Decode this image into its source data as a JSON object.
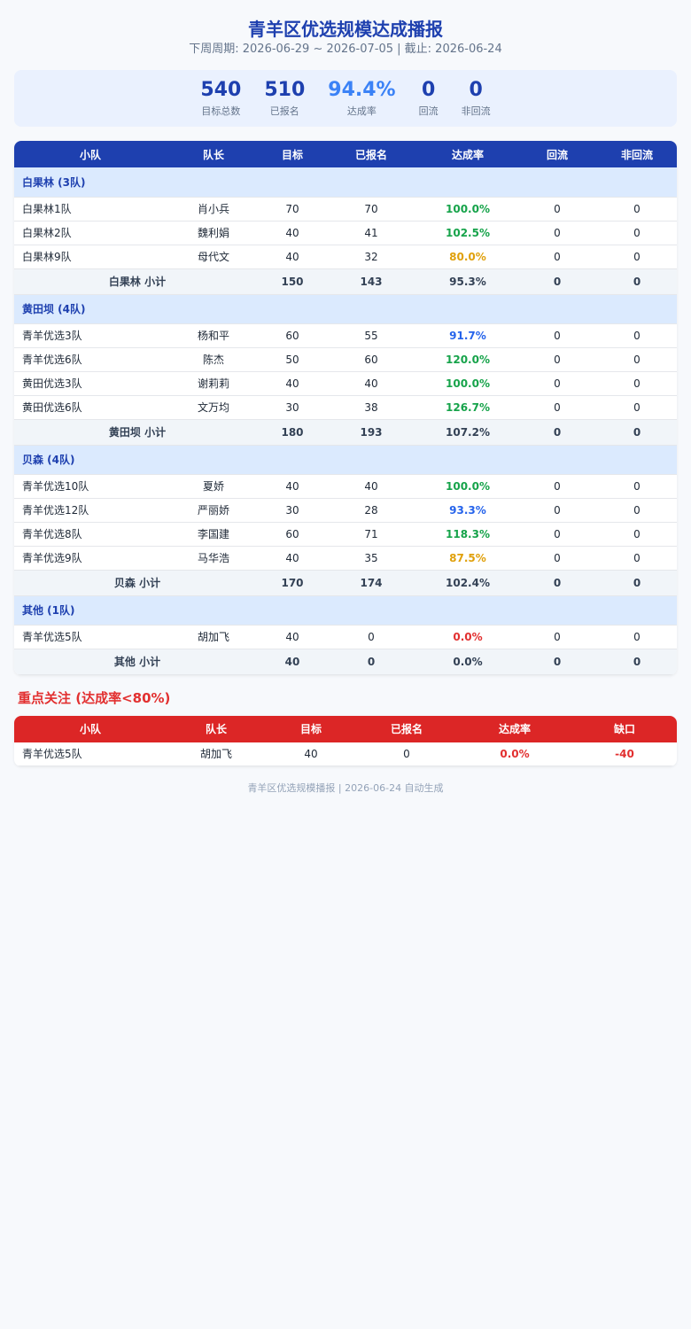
{
  "header": {
    "title": "青羊区优选规模达成播报",
    "subtitle": "下周周期: 2026-06-29 ~ 2026-07-05 | 截止: 2026-06-24"
  },
  "summary": [
    {
      "value": "540",
      "label": "目标总数"
    },
    {
      "value": "510",
      "label": "已报名"
    },
    {
      "value": "94.4%",
      "label": "达成率"
    },
    {
      "value": "0",
      "label": "回流"
    },
    {
      "value": "0",
      "label": "非回流"
    }
  ],
  "main_table": {
    "columns": [
      "小队",
      "队长",
      "目标",
      "已报名",
      "达成率",
      "回流",
      "非回流"
    ],
    "groups": [
      {
        "name": "白果林 (3队)",
        "rows": [
          {
            "team": "白果林1队",
            "leader": "肖小兵",
            "target": "70",
            "signed": "70",
            "rate": "100.0%",
            "rate_color": "green",
            "back": "0",
            "nonback": "0"
          },
          {
            "team": "白果林2队",
            "leader": "魏利娟",
            "target": "40",
            "signed": "41",
            "rate": "102.5%",
            "rate_color": "green",
            "back": "0",
            "nonback": "0"
          },
          {
            "team": "白果林9队",
            "leader": "母代文",
            "target": "40",
            "signed": "32",
            "rate": "80.0%",
            "rate_color": "orange",
            "back": "0",
            "nonback": "0"
          }
        ],
        "subtotal": {
          "label": "白果林 小计",
          "target": "150",
          "signed": "143",
          "rate": "95.3%",
          "back": "0",
          "nonback": "0"
        }
      },
      {
        "name": "黄田坝 (4队)",
        "rows": [
          {
            "team": "青羊优选3队",
            "leader": "杨和平",
            "target": "60",
            "signed": "55",
            "rate": "91.7%",
            "rate_color": "blue",
            "back": "0",
            "nonback": "0"
          },
          {
            "team": "青羊优选6队",
            "leader": "陈杰",
            "target": "50",
            "signed": "60",
            "rate": "120.0%",
            "rate_color": "green",
            "back": "0",
            "nonback": "0"
          },
          {
            "team": "黄田优选3队",
            "leader": "谢莉莉",
            "target": "40",
            "signed": "40",
            "rate": "100.0%",
            "rate_color": "green",
            "back": "0",
            "nonback": "0"
          },
          {
            "team": "黄田优选6队",
            "leader": "文万均",
            "target": "30",
            "signed": "38",
            "rate": "126.7%",
            "rate_color": "green",
            "back": "0",
            "nonback": "0"
          }
        ],
        "subtotal": {
          "label": "黄田坝 小计",
          "target": "180",
          "signed": "193",
          "rate": "107.2%",
          "back": "0",
          "nonback": "0"
        }
      },
      {
        "name": "贝森 (4队)",
        "rows": [
          {
            "team": "青羊优选10队",
            "leader": "夏娇",
            "target": "40",
            "signed": "40",
            "rate": "100.0%",
            "rate_color": "green",
            "back": "0",
            "nonback": "0"
          },
          {
            "team": "青羊优选12队",
            "leader": "严丽娇",
            "target": "30",
            "signed": "28",
            "rate": "93.3%",
            "rate_color": "blue",
            "back": "0",
            "nonback": "0"
          },
          {
            "team": "青羊优选8队",
            "leader": "李国建",
            "target": "60",
            "signed": "71",
            "rate": "118.3%",
            "rate_color": "green",
            "back": "0",
            "nonback": "0"
          },
          {
            "team": "青羊优选9队",
            "leader": "马华浩",
            "target": "40",
            "signed": "35",
            "rate": "87.5%",
            "rate_color": "orange",
            "back": "0",
            "nonback": "0"
          }
        ],
        "subtotal": {
          "label": "贝森 小计",
          "target": "170",
          "signed": "174",
          "rate": "102.4%",
          "back": "0",
          "nonback": "0"
        }
      },
      {
        "name": "其他 (1队)",
        "rows": [
          {
            "team": "青羊优选5队",
            "leader": "胡加飞",
            "target": "40",
            "signed": "0",
            "rate": "0.0%",
            "rate_color": "red",
            "back": "0",
            "nonback": "0"
          }
        ],
        "subtotal": {
          "label": "其他 小计",
          "target": "40",
          "signed": "0",
          "rate": "0.0%",
          "back": "0",
          "nonback": "0"
        }
      }
    ]
  },
  "focus": {
    "title": "重点关注 (达成率<80%)",
    "columns": [
      "小队",
      "队长",
      "目标",
      "已报名",
      "达成率",
      "缺口"
    ],
    "rows": [
      {
        "team": "青羊优选5队",
        "leader": "胡加飞",
        "target": "40",
        "signed": "0",
        "rate": "0.0%",
        "gap": "-40"
      }
    ]
  },
  "footer": "青羊区优选规模播报 | 2026-06-24 自动生成",
  "colors": {
    "primary": "#1e40af",
    "green": "#16a34a",
    "blue": "#2563eb",
    "orange": "#e0a00b",
    "red": "#e23030"
  }
}
